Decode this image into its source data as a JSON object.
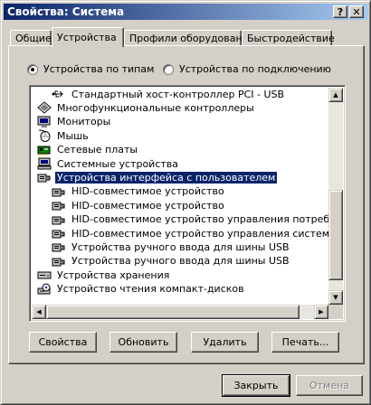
{
  "window": {
    "title": "Свойства: Система",
    "help_label": "?",
    "close_label": "✕"
  },
  "tabs": [
    {
      "label": "Общие"
    },
    {
      "label": "Устройства"
    },
    {
      "label": "Профили оборудования"
    },
    {
      "label": "Быстродействие"
    }
  ],
  "view_mode": {
    "by_type_label": "Устройства по типам",
    "by_connection_label": "Устройства по подключению",
    "selected": "by_type"
  },
  "tree": {
    "rows": [
      {
        "label": "Стандартный хост-контроллер PCI - USB",
        "icon": "usb-icon",
        "level": 1
      },
      {
        "label": "Многофункциональные контроллеры",
        "icon": "multifunction-icon",
        "level": 0
      },
      {
        "label": "Мониторы",
        "icon": "monitor-icon",
        "level": 0
      },
      {
        "label": "Мышь",
        "icon": "mouse-icon",
        "level": 0
      },
      {
        "label": "Сетевые платы",
        "icon": "network-card-icon",
        "level": 0
      },
      {
        "label": "Системные устройства",
        "icon": "computer-icon",
        "level": 0
      },
      {
        "label": "Устройства интерфейса с пользователем",
        "icon": "hid-icon",
        "level": 0,
        "selected": true
      },
      {
        "label": "HID-совместимое устройство",
        "icon": "hid-icon",
        "level": 1
      },
      {
        "label": "HID-совместимое устройство",
        "icon": "hid-icon",
        "level": 1
      },
      {
        "label": "HID-совместимое устройство управления потребителя",
        "icon": "hid-icon",
        "level": 1
      },
      {
        "label": "HID-совместимое устройство управления системой",
        "icon": "hid-icon",
        "level": 1
      },
      {
        "label": "Устройства ручного ввода для шины USB",
        "icon": "hid-icon",
        "level": 1
      },
      {
        "label": "Устройства ручного ввода для шины USB",
        "icon": "hid-icon",
        "level": 1
      },
      {
        "label": "Устройства хранения",
        "icon": "storage-icon",
        "level": 0
      },
      {
        "label": "Устройство чтения компакт-дисков",
        "icon": "cdrom-icon",
        "level": 0
      }
    ],
    "scroll_position": 0.9
  },
  "buttons": {
    "properties": "Свойства",
    "refresh": "Обновить",
    "delete": "Удалить",
    "print": "Печать...",
    "close": "Закрыть",
    "cancel": "Отмена"
  },
  "colors": {
    "title_start": "#0a246a",
    "title_end": "#a6caf0",
    "selection": "#0a246a",
    "face": "#d4d0c8"
  }
}
